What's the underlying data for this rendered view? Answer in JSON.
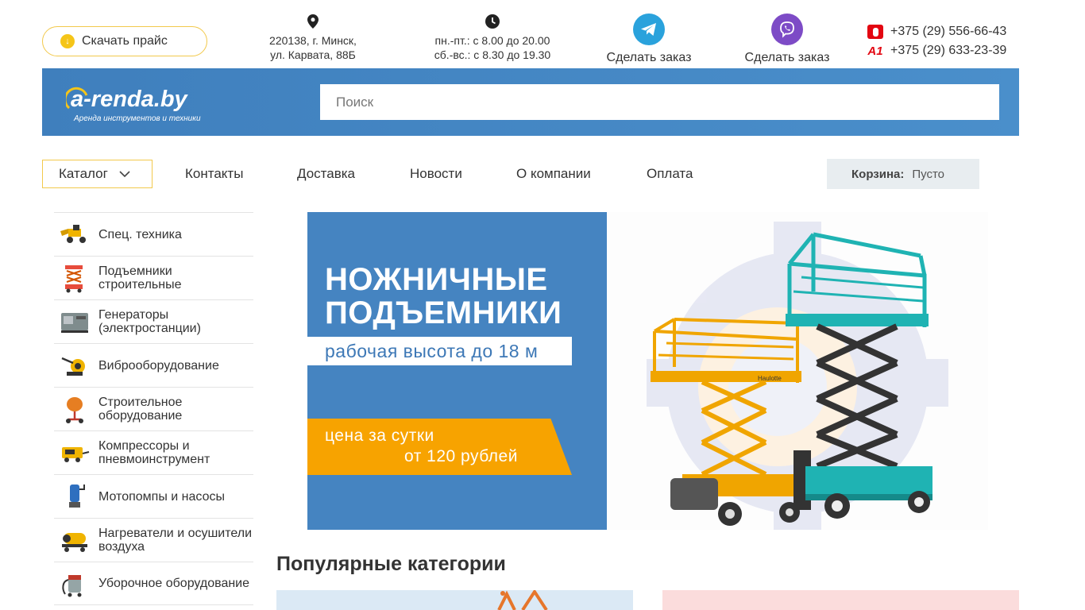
{
  "top": {
    "price_button": "Скачать прайс",
    "address_line1": "220138, г. Минск,",
    "address_line2": "ул. Карвата, 88Б",
    "hours_line1": "пн.-пт.: с 8.00 до 20.00",
    "hours_line2": "сб.-вс.: с 8.30 до 19.30",
    "telegram_label": "Сделать заказ",
    "viber_label": "Сделать заказ",
    "phone_mts": "+375 (29) 556-66-43",
    "phone_a1": "+375 (29) 633-23-39",
    "a1_mark": "A1"
  },
  "header": {
    "logo_text": "a-renda.by",
    "logo_sub": "Аренда инструментов и техники",
    "search_placeholder": "Поиск"
  },
  "nav": {
    "catalog": "Каталог",
    "links": [
      "Контакты",
      "Доставка",
      "Новости",
      "О компании",
      "Оплата"
    ],
    "cart_label": "Корзина:",
    "cart_value": "Пусто"
  },
  "sidebar": {
    "items": [
      {
        "label": "Спец. техника",
        "icon": "loader-icon"
      },
      {
        "label": "Подъемники строительные",
        "icon": "scissor-lift-icon"
      },
      {
        "label": "Генераторы (электростанции)",
        "icon": "generator-icon"
      },
      {
        "label": "Виброоборудование",
        "icon": "vibro-icon"
      },
      {
        "label": "Строительное оборудование",
        "icon": "concrete-mixer-icon"
      },
      {
        "label": "Компрессоры и пневмоинструмент",
        "icon": "compressor-icon"
      },
      {
        "label": "Мотопомпы и насосы",
        "icon": "pump-icon"
      },
      {
        "label": "Нагреватели и осушители воздуха",
        "icon": "heater-icon"
      },
      {
        "label": "Уборочное оборудование",
        "icon": "vacuum-icon"
      }
    ]
  },
  "banner": {
    "title_line1": "НОЖНИЧНЫЕ",
    "title_line2": "ПОДЪЕМНИКИ",
    "subtitle": "рабочая высота до 18 м",
    "price_line1": "цена за сутки",
    "price_line2": "от 120 рублей",
    "lift_brand": "Haulotte"
  },
  "popular": {
    "title": "Популярные категории"
  },
  "colors": {
    "brand_blue": "#4584c1",
    "accent_yellow": "#f5c518",
    "banner_orange": "#f7a300",
    "lift_teal": "#1fb3b3"
  }
}
